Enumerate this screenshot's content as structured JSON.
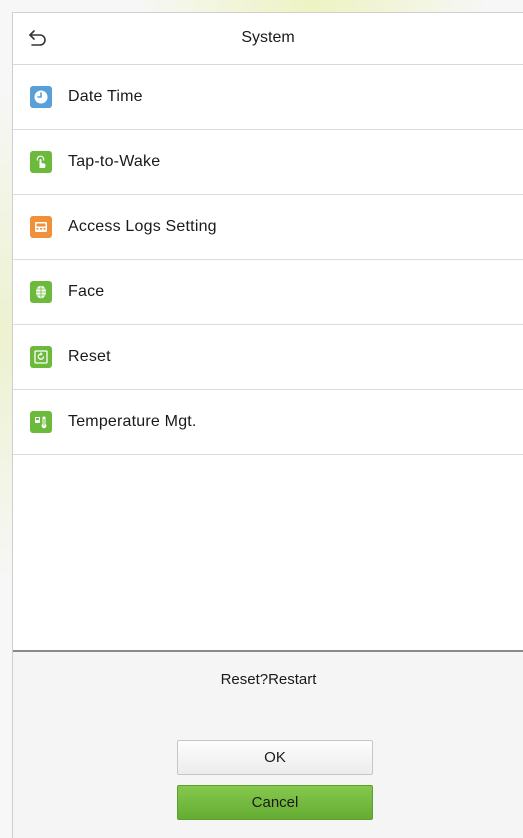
{
  "header": {
    "title": "System",
    "back_icon": "back-arrow-icon"
  },
  "menu": {
    "items": [
      {
        "label": "Date Time",
        "icon": "clock-icon",
        "icon_color": "#5aa0d8"
      },
      {
        "label": "Tap-to-Wake",
        "icon": "tap-hand-icon",
        "icon_color": "#6cba3c"
      },
      {
        "label": "Access Logs Setting",
        "icon": "logs-icon",
        "icon_color": "#f0913a"
      },
      {
        "label": "Face",
        "icon": "face-icon",
        "icon_color": "#6cba3c"
      },
      {
        "label": "Reset",
        "icon": "reset-icon",
        "icon_color": "#6cba3c"
      },
      {
        "label": "Temperature Mgt.",
        "icon": "thermometer-icon",
        "icon_color": "#6cba3c"
      }
    ]
  },
  "dialog": {
    "message": "Reset?Restart",
    "ok_label": "OK",
    "cancel_label": "Cancel",
    "cancel_color": "#6cba3c"
  }
}
